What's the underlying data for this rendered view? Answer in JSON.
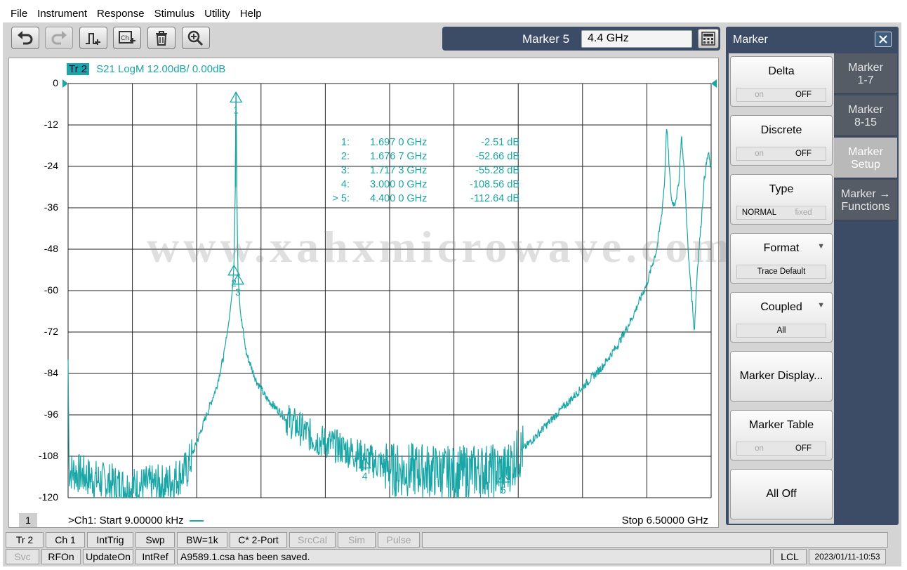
{
  "menu": [
    "File",
    "Instrument",
    "Response",
    "Stimulus",
    "Utility",
    "Help"
  ],
  "toolbar": {
    "icons": [
      "undo-icon",
      "redo-icon",
      "add-marker-icon",
      "add-channel-icon",
      "delete-icon",
      "zoom-icon"
    ]
  },
  "marker_entry": {
    "label": "Marker 5",
    "value": "4.4 GHz"
  },
  "trace": {
    "tag": "Tr 2",
    "desc": "S21 LogM 12.00dB/  0.00dB"
  },
  "chart_data": {
    "type": "line",
    "series_color": "#1aa6a6",
    "xlim_ghz": [
      9e-06,
      6.5
    ],
    "ylim": [
      -120,
      0
    ],
    "yticks": [
      "0",
      "-12",
      "-24",
      "-36",
      "-48",
      "-60",
      "-72",
      "-84",
      "-96",
      "-108",
      "-120"
    ],
    "grid": true,
    "markers": [
      {
        "num": "1:",
        "freq": "1.697 0 GHz",
        "val": "-2.51 dB",
        "x": 1.697,
        "y": -2.51,
        "label": "1"
      },
      {
        "num": "2:",
        "freq": "1.676 7 GHz",
        "val": "-52.66 dB",
        "x": 1.6767,
        "y": -52.66,
        "label": "2"
      },
      {
        "num": "3:",
        "freq": "1.717 3 GHz",
        "val": "-55.28 dB",
        "x": 1.7173,
        "y": -55.28,
        "label": "3"
      },
      {
        "num": "4:",
        "freq": "3.000 0 GHz",
        "val": "-108.56 dB",
        "x": 3.0,
        "y": -108.56,
        "label": "4"
      },
      {
        "num": "> 5:",
        "freq": "4.400 0 GHz",
        "val": "-112.64 dB",
        "x": 4.4,
        "y": -112.64,
        "label": "5"
      }
    ],
    "trace_points": [
      [
        0.0,
        -80
      ],
      [
        0.01,
        -112
      ],
      [
        0.3,
        -115
      ],
      [
        0.6,
        -117
      ],
      [
        1.0,
        -116
      ],
      [
        1.2,
        -112
      ],
      [
        1.3,
        -104
      ],
      [
        1.4,
        -96
      ],
      [
        1.5,
        -88
      ],
      [
        1.58,
        -78
      ],
      [
        1.63,
        -68
      ],
      [
        1.66,
        -60
      ],
      [
        1.6767,
        -52.66
      ],
      [
        1.69,
        -30
      ],
      [
        1.697,
        -2.51
      ],
      [
        1.705,
        -30
      ],
      [
        1.7173,
        -55.28
      ],
      [
        1.74,
        -66
      ],
      [
        1.8,
        -78
      ],
      [
        1.9,
        -86
      ],
      [
        2.0,
        -91
      ],
      [
        2.2,
        -97
      ],
      [
        2.5,
        -103
      ],
      [
        2.8,
        -106
      ],
      [
        3.0,
        -108.56
      ],
      [
        3.3,
        -112
      ],
      [
        3.6,
        -112
      ],
      [
        3.9,
        -113
      ],
      [
        4.2,
        -112
      ],
      [
        4.4,
        -112.64
      ],
      [
        4.6,
        -106
      ],
      [
        4.8,
        -100
      ],
      [
        5.0,
        -94
      ],
      [
        5.2,
        -88
      ],
      [
        5.4,
        -82
      ],
      [
        5.55,
        -76
      ],
      [
        5.7,
        -68
      ],
      [
        5.85,
        -58
      ],
      [
        5.95,
        -48
      ],
      [
        6.0,
        -38
      ],
      [
        6.03,
        -28
      ],
      [
        6.05,
        -12
      ],
      [
        6.08,
        -26
      ],
      [
        6.1,
        -34
      ],
      [
        6.13,
        -35
      ],
      [
        6.17,
        -30
      ],
      [
        6.2,
        -15
      ],
      [
        6.23,
        -26
      ],
      [
        6.27,
        -50
      ],
      [
        6.3,
        -60
      ],
      [
        6.33,
        -72
      ],
      [
        6.36,
        -54
      ],
      [
        6.4,
        -40
      ],
      [
        6.43,
        -28
      ],
      [
        6.47,
        -20
      ],
      [
        6.5,
        -25
      ]
    ],
    "noise_regions": [
      [
        0.01,
        1.25,
        6
      ],
      [
        1.6,
        1.75,
        0
      ],
      [
        2.2,
        3.2,
        5
      ],
      [
        3.2,
        4.6,
        8
      ]
    ]
  },
  "watermark": "www.xahxmicrowave.com",
  "footer": {
    "channel_num": "1",
    "start": ">Ch1:  Start  9.00000 kHz",
    "stop": "Stop  6.50000 GHz"
  },
  "side_panel": {
    "title": "Marker",
    "buttons": [
      {
        "title": "Delta",
        "opt_a": "on",
        "opt_b": "OFF"
      },
      {
        "title": "Discrete",
        "opt_a": "on",
        "opt_b": "OFF"
      },
      {
        "title": "Type",
        "opt_a": "NORMAL",
        "opt_b": "fixed"
      },
      {
        "title": "Format",
        "value": "Trace Default"
      },
      {
        "title": "Coupled",
        "value": "All"
      },
      {
        "title": "Marker Display..."
      },
      {
        "title": "Marker Table",
        "opt_a": "on",
        "opt_b": "OFF"
      },
      {
        "title": "All Off"
      }
    ],
    "tabs": [
      {
        "line1": "Marker",
        "line2": "1-7"
      },
      {
        "line1": "Marker",
        "line2": "8-15"
      },
      {
        "line1": "Marker",
        "line2": "Setup"
      },
      {
        "line1": "Marker →",
        "line2": "Functions"
      }
    ]
  },
  "status_top": [
    "Tr 2",
    "Ch 1",
    "IntTrig",
    "Swp",
    "BW=1k",
    "C* 2-Port",
    "SrcCal",
    "Sim",
    "Pulse"
  ],
  "status_bottom": {
    "svc": "Svc",
    "rfon": "RFOn",
    "update": "UpdateOn",
    "intref": "IntRef",
    "message": "A9589.1.csa has been saved.",
    "lcl": "LCL",
    "datetime": "2023/01/11-10:53"
  }
}
